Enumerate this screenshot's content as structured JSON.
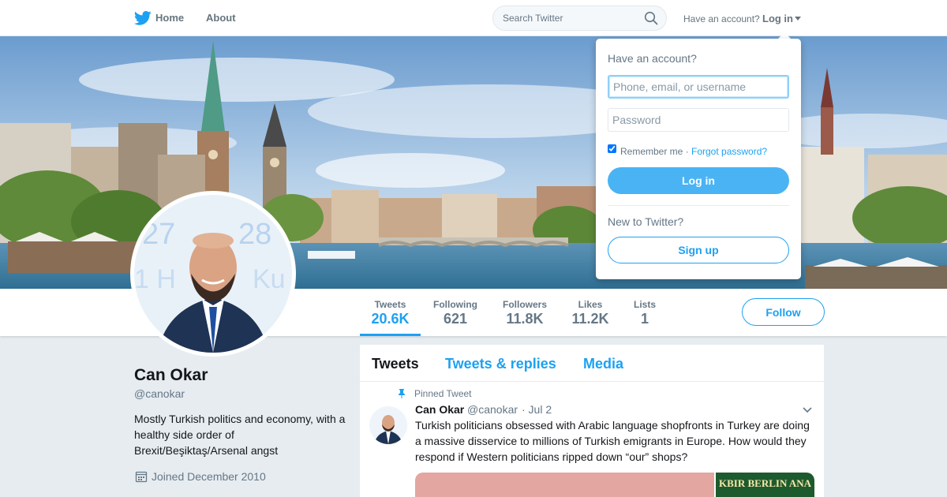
{
  "nav": {
    "home_label": "Home",
    "about_label": "About",
    "search_placeholder": "Search Twitter",
    "have_account_label": "Have an account?",
    "login_label": "Log in"
  },
  "profile": {
    "name": "Can Okar",
    "handle": "@canokar",
    "bio": "Mostly Turkish politics and economy, with a healthy side order of Brexit/Beşiktaş/Arsenal angst",
    "joined": "Joined December 2010"
  },
  "stats": [
    {
      "label": "Tweets",
      "value": "20.6K"
    },
    {
      "label": "Following",
      "value": "621"
    },
    {
      "label": "Followers",
      "value": "11.8K"
    },
    {
      "label": "Likes",
      "value": "11.2K"
    },
    {
      "label": "Lists",
      "value": "1"
    }
  ],
  "follow_label": "Follow",
  "timeline": {
    "tabs": [
      "Tweets",
      "Tweets & replies",
      "Media"
    ],
    "pinned_label": "Pinned Tweet",
    "tweet": {
      "name": "Can Okar",
      "handle": "@canokar",
      "date": "· Jul 2",
      "text": "Turkish politicians obsessed with Arabic language shopfronts in Turkey are doing a massive disservice to millions of Turkish emigrants in Europe. How would they respond if Western politicians ripped down “our” shops?",
      "media_sign_text": "KBIR BERLIN ANA"
    }
  },
  "login_dropdown": {
    "title": "Have an account?",
    "username_placeholder": "Phone, email, or username",
    "password_placeholder": "Password",
    "remember_label": "Remember me ·",
    "forgot_label": "Forgot password?",
    "login_button": "Log in",
    "new_label": "New to Twitter?",
    "signup_button": "Sign up"
  },
  "colors": {
    "brand_blue": "#1da1f2",
    "login_button_blue": "#4ab3f4",
    "background": "#e6ecf0"
  },
  "icons": {
    "logo": "twitter-bird-icon",
    "search": "magnifier-icon",
    "joined": "calendar-icon",
    "pinned": "pin-icon",
    "more": "chevron-down-icon"
  }
}
